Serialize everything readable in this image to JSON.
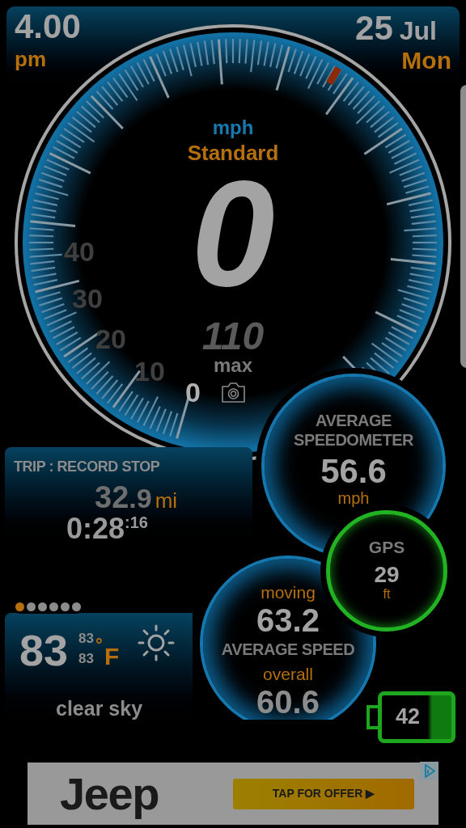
{
  "header": {
    "time": "4.00",
    "meridiem": "pm",
    "day": "25",
    "month": "Jul",
    "weekday": "Mon"
  },
  "speedometer": {
    "unit": "mph",
    "mode": "Standard",
    "speed": "0",
    "max_speed": "110",
    "max_label": "max",
    "scale_labels": [
      {
        "text": "0",
        "highlighted": true
      },
      {
        "text": "10",
        "highlighted": false
      },
      {
        "text": "20",
        "highlighted": false
      },
      {
        "text": "30",
        "highlighted": false
      },
      {
        "text": "40",
        "highlighted": false
      }
    ]
  },
  "trip": {
    "title": "TRIP : RECORD STOP",
    "distance": "32",
    "distance_decimal": ".9",
    "distance_unit": "mi",
    "duration": "0:28",
    "duration_seconds": ":16"
  },
  "average_speedometer": {
    "label_lines": [
      "AVERAGE",
      "SPEEDOMETER"
    ],
    "value": "56.6",
    "unit": "mph"
  },
  "gps": {
    "label": "GPS",
    "value": "29",
    "unit": "ft"
  },
  "average_speed": {
    "moving_label": "moving",
    "moving_value": "63.2",
    "title": "AVERAGE SPEED",
    "overall_label": "overall",
    "overall_value": "60.6"
  },
  "weather": {
    "pages": [
      {
        "selected": true
      },
      {
        "selected": false
      },
      {
        "selected": false
      },
      {
        "selected": false
      },
      {
        "selected": false
      },
      {
        "selected": false
      }
    ],
    "temperature": "83",
    "high": "83",
    "low": "83",
    "degree": "°",
    "unit": "F",
    "condition": "clear sky"
  },
  "battery": {
    "value": "42"
  },
  "ad": {
    "brand": "Jeep",
    "button": "TAP FOR OFFER ▶"
  }
}
